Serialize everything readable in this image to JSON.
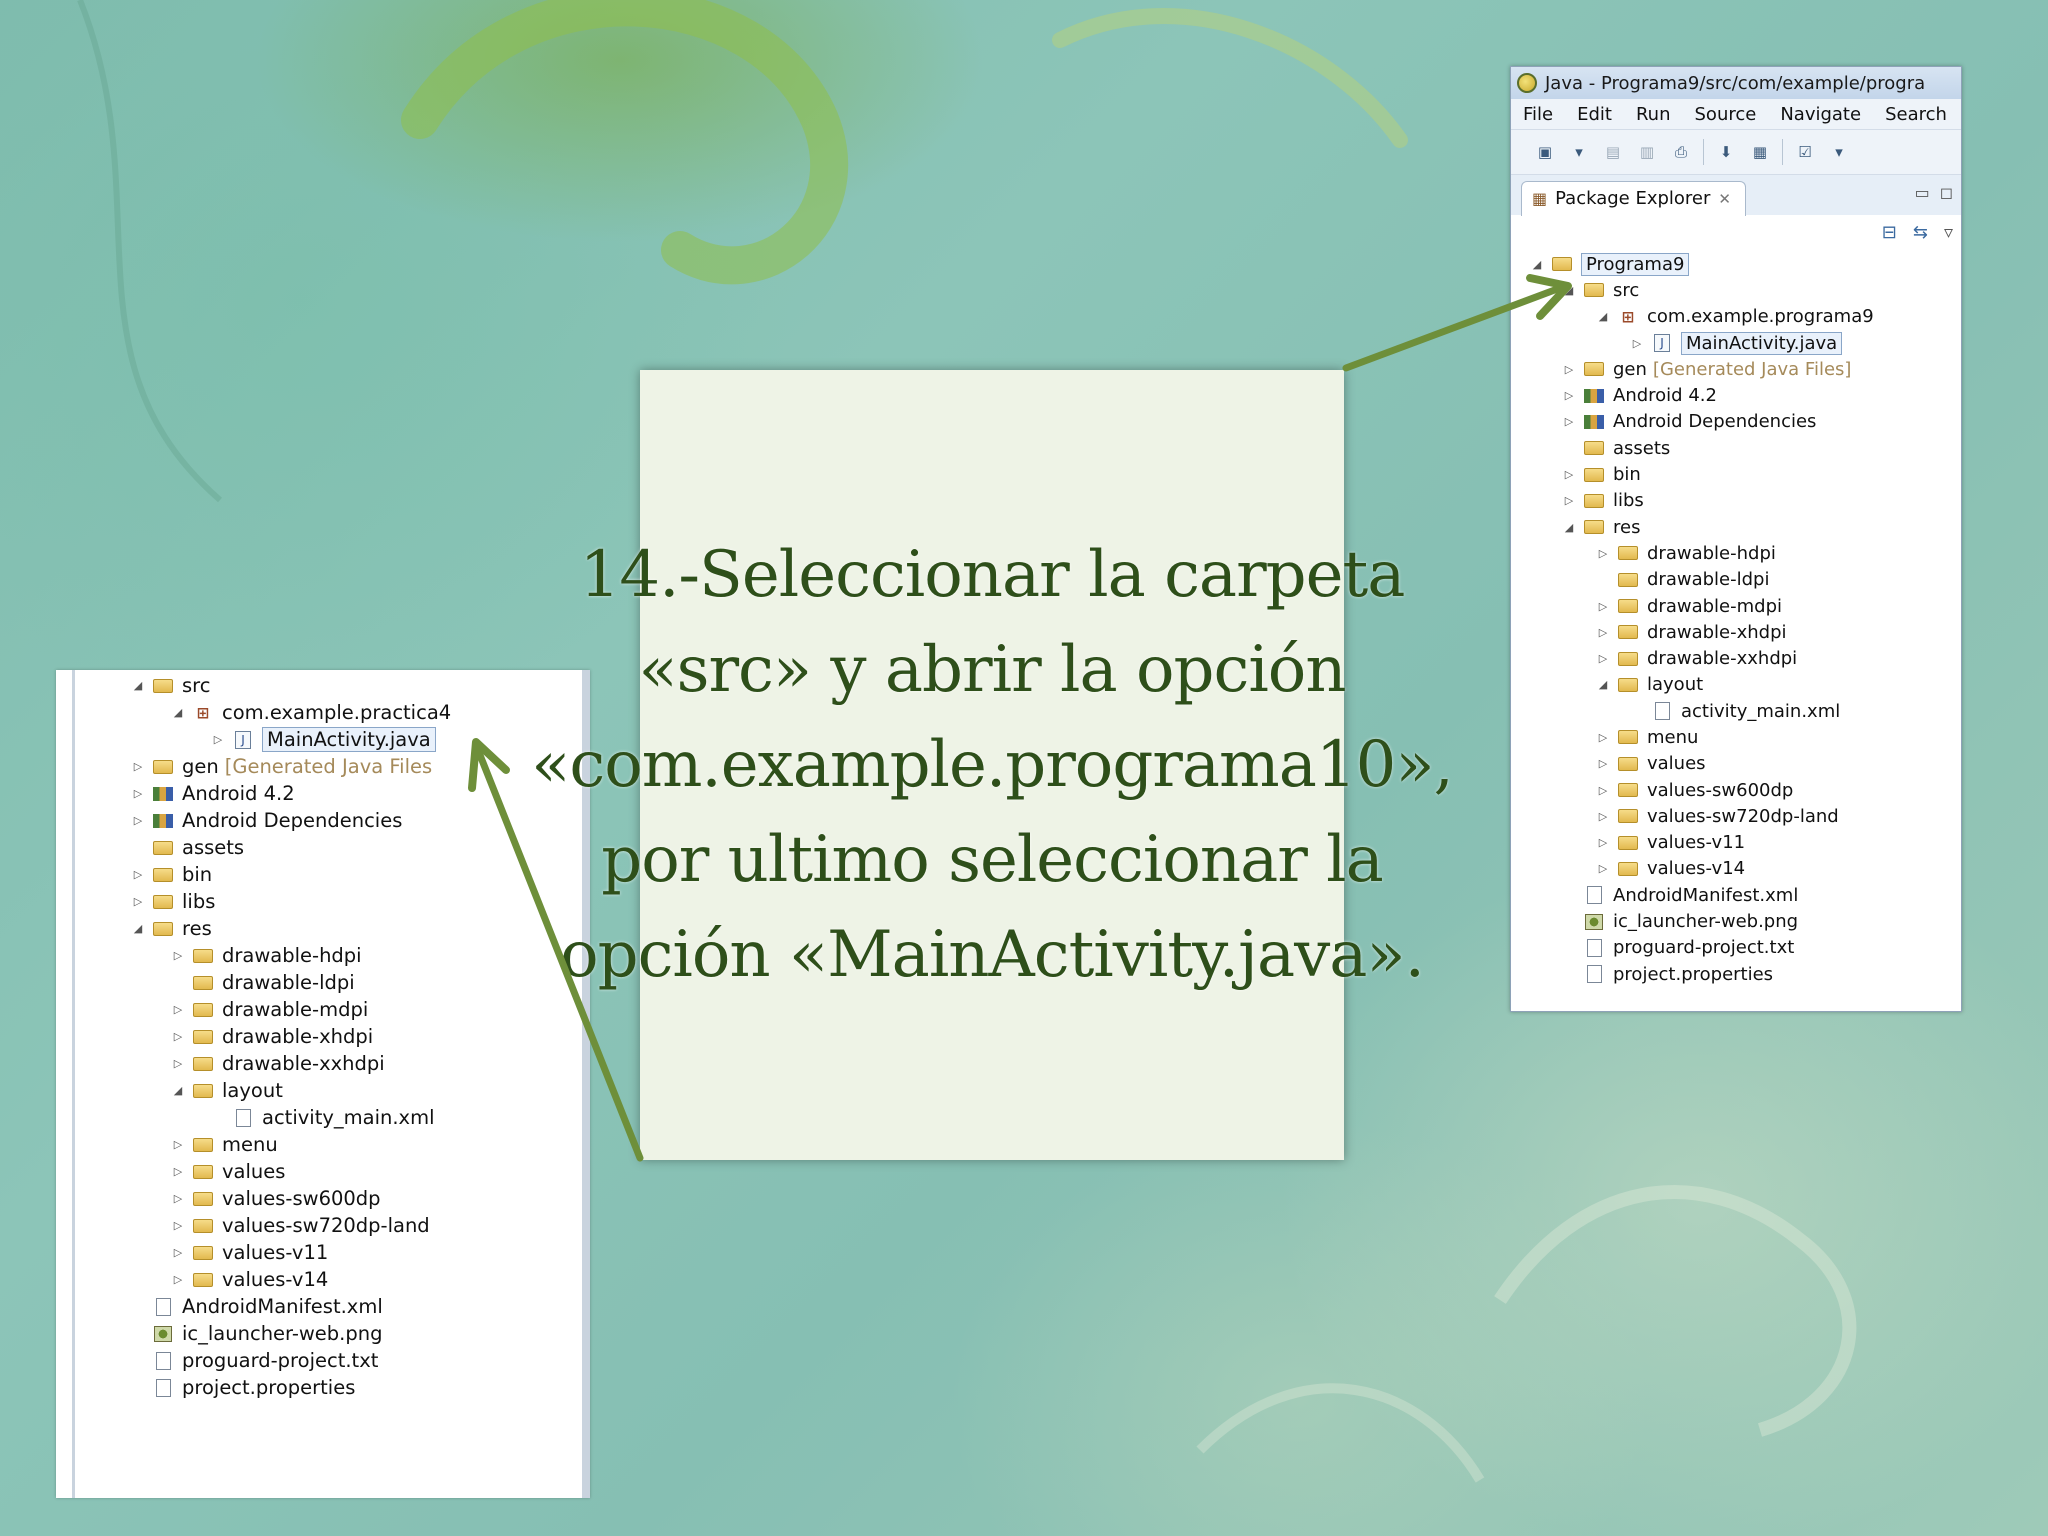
{
  "instruction": "14.-Seleccionar la carpeta «src» y abrir la opción «com.example.programa10», por ultimo seleccionar la opción «MainActivity.java».",
  "eclipse": {
    "title": "Java - Programa9/src/com/example/progra",
    "menu": [
      "File",
      "Edit",
      "Run",
      "Source",
      "Navigate",
      "Search"
    ],
    "view_tab": "Package Explorer",
    "tree": {
      "project": "Programa9",
      "src": "src",
      "package": "com.example.programa9",
      "main_activity": "MainActivity.java",
      "gen": "gen",
      "gen_note": "[Generated Java Files]",
      "android": "Android 4.2",
      "deps": "Android Dependencies",
      "assets": "assets",
      "bin": "bin",
      "libs": "libs",
      "res": "res",
      "drawable_hdpi": "drawable-hdpi",
      "drawable_ldpi": "drawable-ldpi",
      "drawable_mdpi": "drawable-mdpi",
      "drawable_xhdpi": "drawable-xhdpi",
      "drawable_xxhdpi": "drawable-xxhdpi",
      "layout": "layout",
      "activity_main": "activity_main.xml",
      "menu": "menu",
      "values": "values",
      "values_sw600": "values-sw600dp",
      "values_sw720": "values-sw720dp-land",
      "values_v11": "values-v11",
      "values_v14": "values-v14",
      "manifest": "AndroidManifest.xml",
      "ic_launcher": "ic_launcher-web.png",
      "proguard": "proguard-project.txt",
      "properties": "project.properties"
    }
  },
  "left_tree": {
    "src": "src",
    "package": "com.example.practica4",
    "main_activity": "MainActivity.java",
    "gen": "gen",
    "gen_note": "[Generated Java Files",
    "android": "Android 4.2",
    "deps": "Android Dependencies",
    "assets": "assets",
    "bin": "bin",
    "libs": "libs",
    "res": "res",
    "drawable_hdpi": "drawable-hdpi",
    "drawable_ldpi": "drawable-ldpi",
    "drawable_mdpi": "drawable-mdpi",
    "drawable_xhdpi": "drawable-xhdpi",
    "drawable_xxhdpi": "drawable-xxhdpi",
    "layout": "layout",
    "activity_main": "activity_main.xml",
    "menu": "menu",
    "values": "values",
    "values_sw600": "values-sw600dp",
    "values_sw720": "values-sw720dp-land",
    "values_v11": "values-v11",
    "values_v14": "values-v14",
    "manifest": "AndroidManifest.xml",
    "ic_launcher": "ic_launcher-web.png",
    "proguard": "proguard-project.txt",
    "properties": "project.properties"
  },
  "colors": {
    "background": "#86bfb3",
    "arrow": "#6e8f3a",
    "instruction_text": "#2e4f1a",
    "textbox_bg": "#eef3e6"
  },
  "icons": [
    "eclipse-icon",
    "package-explorer-icon",
    "folder-icon",
    "package-icon",
    "java-file-icon",
    "library-icon",
    "xml-file-icon",
    "image-file-icon",
    "text-file-icon",
    "arrow"
  ]
}
